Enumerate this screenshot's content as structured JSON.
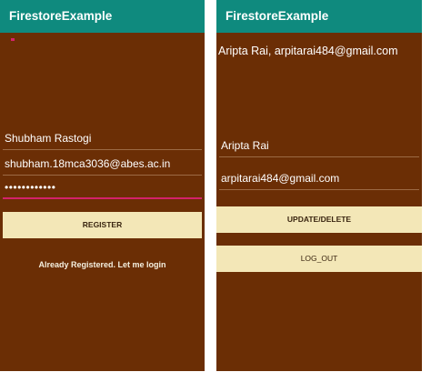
{
  "left_screen": {
    "app_title": "FirestoreExample",
    "name_value": "Shubham Rastogi",
    "email_value": "shubham.18mca3036@abes.ac.in",
    "password_value": "••••••••••••",
    "register_label": "REGISTER",
    "login_link": "Already Registered. Let me login"
  },
  "right_screen": {
    "app_title": "FirestoreExample",
    "user_info": "Aripta Rai, arpitarai484@gmail.com",
    "name_value": "Aripta Rai",
    "email_value": "arpitarai484@gmail.com",
    "update_delete_label": "UPDATE/DELETE",
    "logout_label": "LOG_OUT"
  },
  "colors": {
    "app_bar": "#0f8a7e",
    "background": "#6b2e05",
    "button": "#f3e7b7",
    "focus_underline": "#d4226a"
  }
}
